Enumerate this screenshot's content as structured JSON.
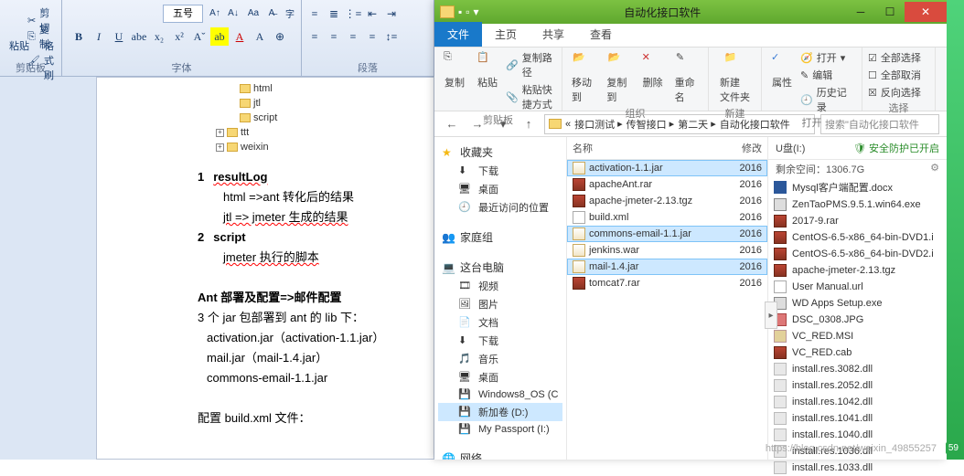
{
  "word": {
    "clipboard": {
      "paste_label": "粘贴",
      "cut_label": "剪切",
      "copy_label": "复制",
      "format_painter_label": "格式刷",
      "group_label": "剪贴板"
    },
    "font": {
      "size_label": "五号",
      "group_label": "字体"
    },
    "paragraph": {
      "group_label": "段落"
    },
    "tree": {
      "items": [
        "html",
        "jtl",
        "script",
        "ttt",
        "weixin"
      ]
    },
    "doc": {
      "line1_num": "1",
      "line1_bold": "resultLog",
      "line2": "html =>ant 转化后的结果",
      "line3": "jtl => jmeter 生成的结果",
      "line4_num": "2",
      "line4_bold": "script",
      "line5": "jmeter 执行的脚本",
      "blank": "",
      "line7_bold": "Ant 部署及配置=>邮件配置",
      "line8": "3 个 jar 包部署到 ant 的 lib 下：",
      "line9": "activation.jar（activation-1.1.jar）",
      "line10": "mail.jar（mail-1.4.jar）",
      "line11": "commons-email-1.1.jar",
      "line13": "配置 build.xml 文件："
    }
  },
  "explorer": {
    "title": "自动化接口软件",
    "tabs": {
      "file": "文件",
      "home": "主页",
      "share": "共享",
      "view": "查看"
    },
    "ribbon": {
      "copy": "复制",
      "paste": "粘贴",
      "copypath": "复制路径",
      "pasteshort": "粘贴快捷方式",
      "clip_label": "剪贴板",
      "moveto": "移动到",
      "copyto": "复制到",
      "delete": "删除",
      "rename": "重命名",
      "org_label": "组织",
      "newfolder": "新建\n文件夹",
      "new_label": "新建",
      "open": "打开",
      "edit": "编辑",
      "history": "历史记录",
      "props": "属性",
      "open_label": "打开",
      "selectall": "全部选择",
      "selectnone": "全部取消",
      "invert": "反向选择",
      "select_label": "选择"
    },
    "address": {
      "segs": [
        "接口测试",
        "传智接口",
        "第二天",
        "自动化接口软件"
      ],
      "search_placeholder": "搜索\"自动化接口软件"
    },
    "nav": {
      "favorites": "收藏夹",
      "downloads": "下载",
      "desktop": "桌面",
      "recent": "最近访问的位置",
      "homegroup": "家庭组",
      "thispc": "这台电脑",
      "videos": "视频",
      "pictures": "图片",
      "documents": "文档",
      "downloads2": "下载",
      "music": "音乐",
      "desktop2": "桌面",
      "osdrive": "Windows8_OS (C",
      "ddrive": "新加卷 (D:)",
      "passport": "My Passport (I:)",
      "network": "网络"
    },
    "filecols": {
      "name": "名称",
      "modified": "修改"
    },
    "files": [
      {
        "name": "activation-1.1.jar",
        "date": "2016",
        "type": "jar",
        "sel": true
      },
      {
        "name": "apacheAnt.rar",
        "date": "2016",
        "type": "rar"
      },
      {
        "name": "apache-jmeter-2.13.tgz",
        "date": "2016",
        "type": "tgz"
      },
      {
        "name": "build.xml",
        "date": "2016",
        "type": "xml"
      },
      {
        "name": "commons-email-1.1.jar",
        "date": "2016",
        "type": "jar",
        "sel": true
      },
      {
        "name": "jenkins.war",
        "date": "2016",
        "type": "war"
      },
      {
        "name": "mail-1.4.jar",
        "date": "2016",
        "type": "jar",
        "sel": true
      },
      {
        "name": "tomcat7.rar",
        "date": "2016",
        "type": "rar"
      }
    ],
    "usb": {
      "title": "U盘(I:)",
      "safety": "安全防护已开启",
      "space": "剩余空间：1306.7G",
      "files": [
        {
          "name": "Mysql客户端配置.docx",
          "type": "docx"
        },
        {
          "name": "ZenTaoPMS.9.5.1.win64.exe",
          "type": "exe"
        },
        {
          "name": "2017-9.rar",
          "type": "rar"
        },
        {
          "name": "CentOS-6.5-x86_64-bin-DVD1.i",
          "type": "rar"
        },
        {
          "name": "CentOS-6.5-x86_64-bin-DVD2.i",
          "type": "rar"
        },
        {
          "name": "apache-jmeter-2.13.tgz",
          "type": "tgz"
        },
        {
          "name": "User Manual.url",
          "type": "url"
        },
        {
          "name": "WD Apps Setup.exe",
          "type": "exe"
        },
        {
          "name": "DSC_0308.JPG",
          "type": "jpg"
        },
        {
          "name": "VC_RED.MSI",
          "type": "msi"
        },
        {
          "name": "VC_RED.cab",
          "type": "cab"
        },
        {
          "name": "install.res.3082.dll",
          "type": "dll"
        },
        {
          "name": "install.res.2052.dll",
          "type": "dll"
        },
        {
          "name": "install.res.1042.dll",
          "type": "dll"
        },
        {
          "name": "install.res.1041.dll",
          "type": "dll"
        },
        {
          "name": "install.res.1040.dll",
          "type": "dll"
        },
        {
          "name": "install.res.1036.dll",
          "type": "dll"
        },
        {
          "name": "install.res.1033.dll",
          "type": "dll"
        }
      ]
    }
  },
  "watermark": "https://blog.csdn.net/weixin_49855257"
}
